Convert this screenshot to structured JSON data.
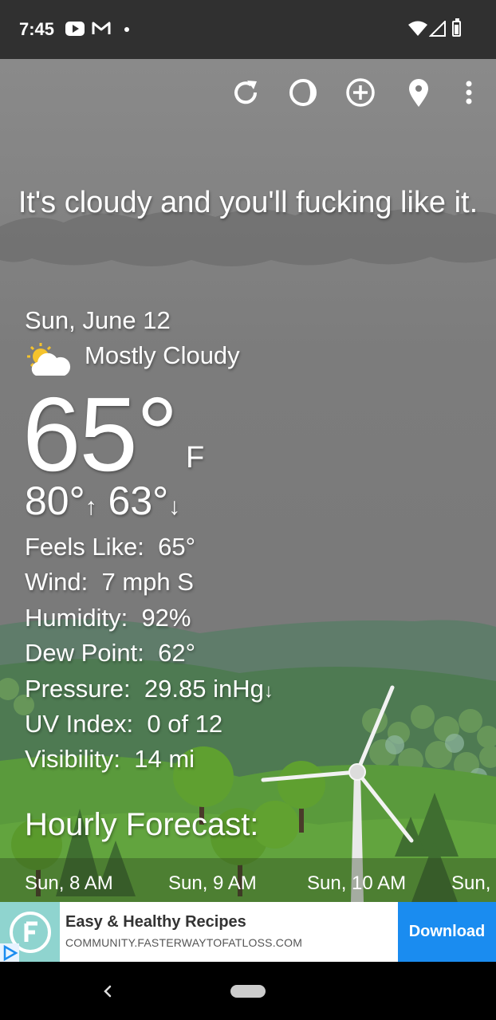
{
  "status_bar": {
    "time": "7:45",
    "icons": [
      "youtube-icon",
      "gmail-icon",
      "notification-dot",
      "wifi-icon",
      "signal-icon",
      "battery-icon"
    ]
  },
  "toolbar": {
    "icons": [
      "refresh-icon",
      "theme-icon",
      "add-location-icon",
      "location-pin-icon",
      "more-options-icon"
    ]
  },
  "headline": "It's cloudy and you'll fucking like it.",
  "current": {
    "date": "Sun, June 12",
    "condition": "Mostly Cloudy",
    "condition_icon": "partly-cloudy-icon",
    "temperature": "65°",
    "unit": "F",
    "high": "80°",
    "low": "63°",
    "details": [
      {
        "label": "Feels Like:",
        "value": "65°"
      },
      {
        "label": "Wind:",
        "value": "7 mph S"
      },
      {
        "label": "Humidity:",
        "value": "92%"
      },
      {
        "label": "Dew Point:",
        "value": "62°"
      },
      {
        "label": "Pressure:",
        "value": "29.85 inHg"
      },
      {
        "label": "UV Index:",
        "value": "0 of 12"
      },
      {
        "label": "Visibility:",
        "value": "14 mi"
      }
    ]
  },
  "hourly": {
    "title": "Hourly Forecast:",
    "hours": [
      "Sun, 8 AM",
      "Sun, 9 AM",
      "Sun, 10 AM",
      "Sun,"
    ]
  },
  "ad": {
    "title": "Easy & Healthy Recipes",
    "url": "COMMUNITY.FASTERWAYTOFATLOSS.COM",
    "button": "Download"
  },
  "colors": {
    "status_bar": "#303030",
    "sky": "#7c7c7c",
    "ad_button": "#1a8cf0",
    "nav_bar": "#000000"
  }
}
